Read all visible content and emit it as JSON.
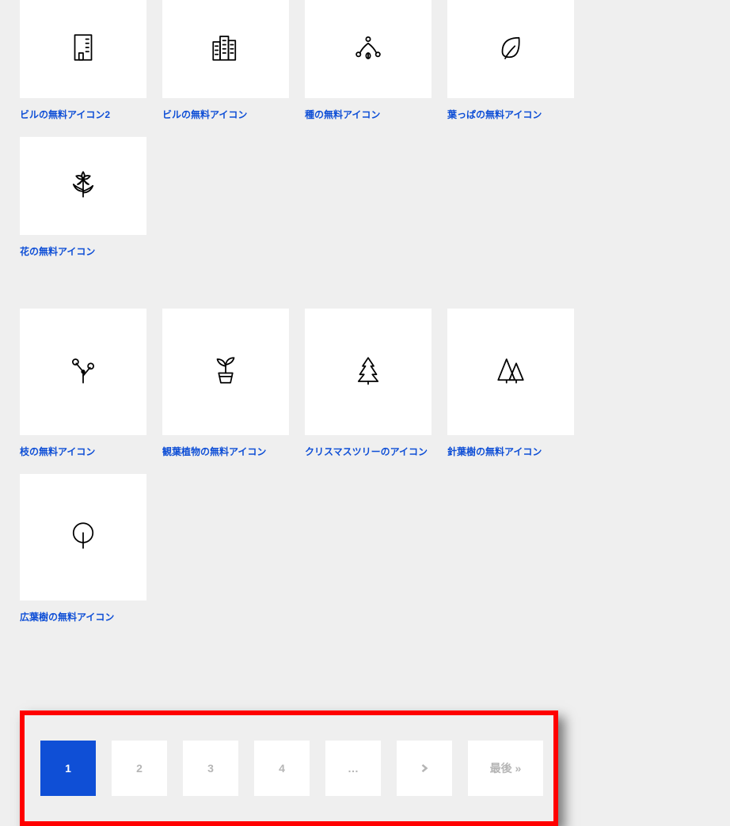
{
  "icons_row1": [
    {
      "name": "building-icon",
      "label": "ビルの無料アイコン2"
    },
    {
      "name": "buildings-icon",
      "label": "ビルの無料アイコン"
    },
    {
      "name": "seed-icon",
      "label": "種の無料アイコン"
    },
    {
      "name": "leaf-icon",
      "label": "葉っぱの無料アイコン"
    },
    {
      "name": "flower-icon",
      "label": "花の無料アイコン"
    }
  ],
  "icons_row2": [
    {
      "name": "branch-icon",
      "label": "枝の無料アイコン"
    },
    {
      "name": "houseplant-icon",
      "label": "観葉植物の無料アイコン"
    },
    {
      "name": "christmas-tree-icon",
      "label": "クリスマスツリーのアイコン"
    },
    {
      "name": "conifer-icon",
      "label": "針葉樹の無料アイコン"
    },
    {
      "name": "broadleaf-tree-icon",
      "label": "広葉樹の無料アイコン"
    }
  ],
  "pagination": {
    "pages": [
      "1",
      "2",
      "3",
      "4"
    ],
    "ellipsis": "…",
    "next": ">",
    "last": "最後 »",
    "current": 0
  }
}
